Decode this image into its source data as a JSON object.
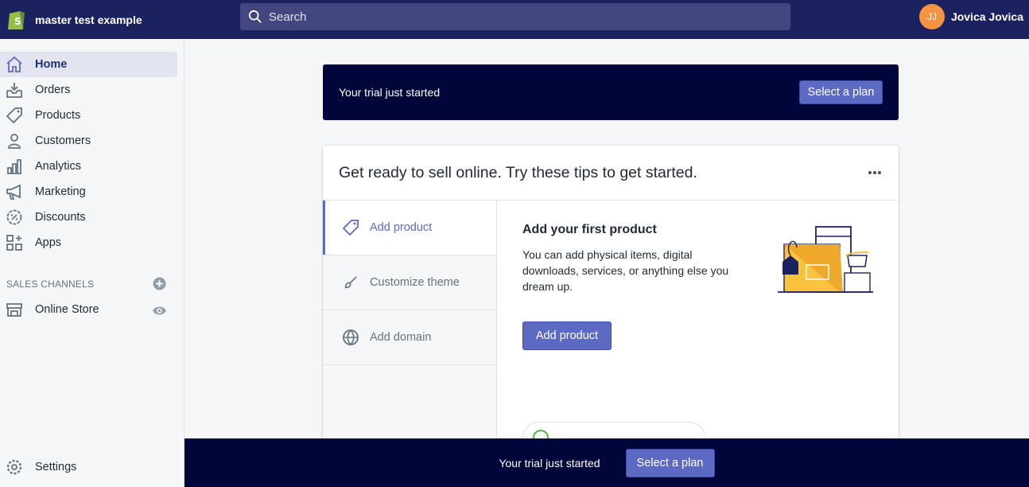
{
  "topbar": {
    "store_name": "master test example",
    "search_placeholder": "Search",
    "user_initials": "JJ",
    "user_name": "Jovica Jovica"
  },
  "sidebar": {
    "items": [
      {
        "label": "Home",
        "icon": "home-icon",
        "active": true
      },
      {
        "label": "Orders",
        "icon": "orders-icon"
      },
      {
        "label": "Products",
        "icon": "tag-icon"
      },
      {
        "label": "Customers",
        "icon": "customer-icon"
      },
      {
        "label": "Analytics",
        "icon": "analytics-icon"
      },
      {
        "label": "Marketing",
        "icon": "megaphone-icon"
      },
      {
        "label": "Discounts",
        "icon": "discount-icon"
      },
      {
        "label": "Apps",
        "icon": "apps-icon"
      }
    ],
    "sales_channels_heading": "SALES CHANNELS",
    "online_store_label": "Online Store",
    "settings_label": "Settings"
  },
  "trial_banner": {
    "text": "Your trial just started",
    "button": "Select a plan"
  },
  "setup_card": {
    "title": "Get ready to sell online. Try these tips to get started.",
    "tabs": [
      {
        "label": "Add product",
        "icon": "tag-icon"
      },
      {
        "label": "Customize theme",
        "icon": "brush-icon"
      },
      {
        "label": "Add domain",
        "icon": "globe-icon"
      }
    ],
    "panel": {
      "heading": "Add your first product",
      "description": "You can add physical items, digital downloads, services, or anything else you dream up.",
      "button": "Add product"
    }
  },
  "bottom_bar": {
    "text": "Your trial just started",
    "button": "Select a plan"
  },
  "colors": {
    "topbar": "#1c2260",
    "banner": "#000639",
    "accent": "#5c6ac4",
    "avatar": "#f49342",
    "illustration": "#f8c43f"
  }
}
